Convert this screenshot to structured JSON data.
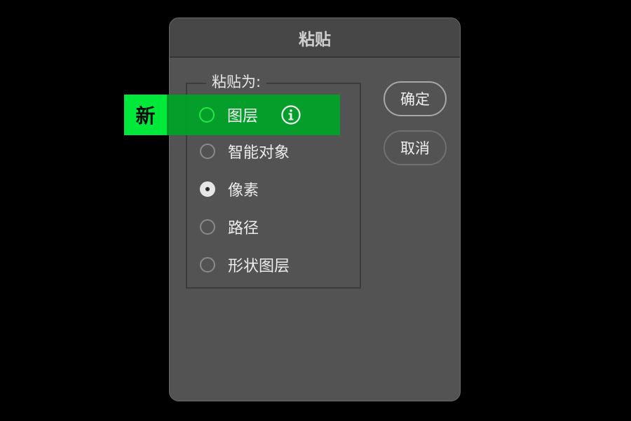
{
  "dialog": {
    "title": "粘贴"
  },
  "paste_as": {
    "legend": "粘贴为:",
    "options": [
      {
        "label": "图层",
        "selected": false,
        "is_new": true
      },
      {
        "label": "智能对象",
        "selected": false
      },
      {
        "label": "像素",
        "selected": true
      },
      {
        "label": "路径",
        "selected": false
      },
      {
        "label": "形状图层",
        "selected": false
      }
    ]
  },
  "buttons": {
    "ok_label": "确定",
    "cancel_label": "取消"
  },
  "badge": {
    "new_label": "新",
    "info_icon": "info-circle-icon"
  },
  "colors": {
    "highlight": "#00a528",
    "new_badge": "#00e83a",
    "dialog_bg": "#535353"
  }
}
